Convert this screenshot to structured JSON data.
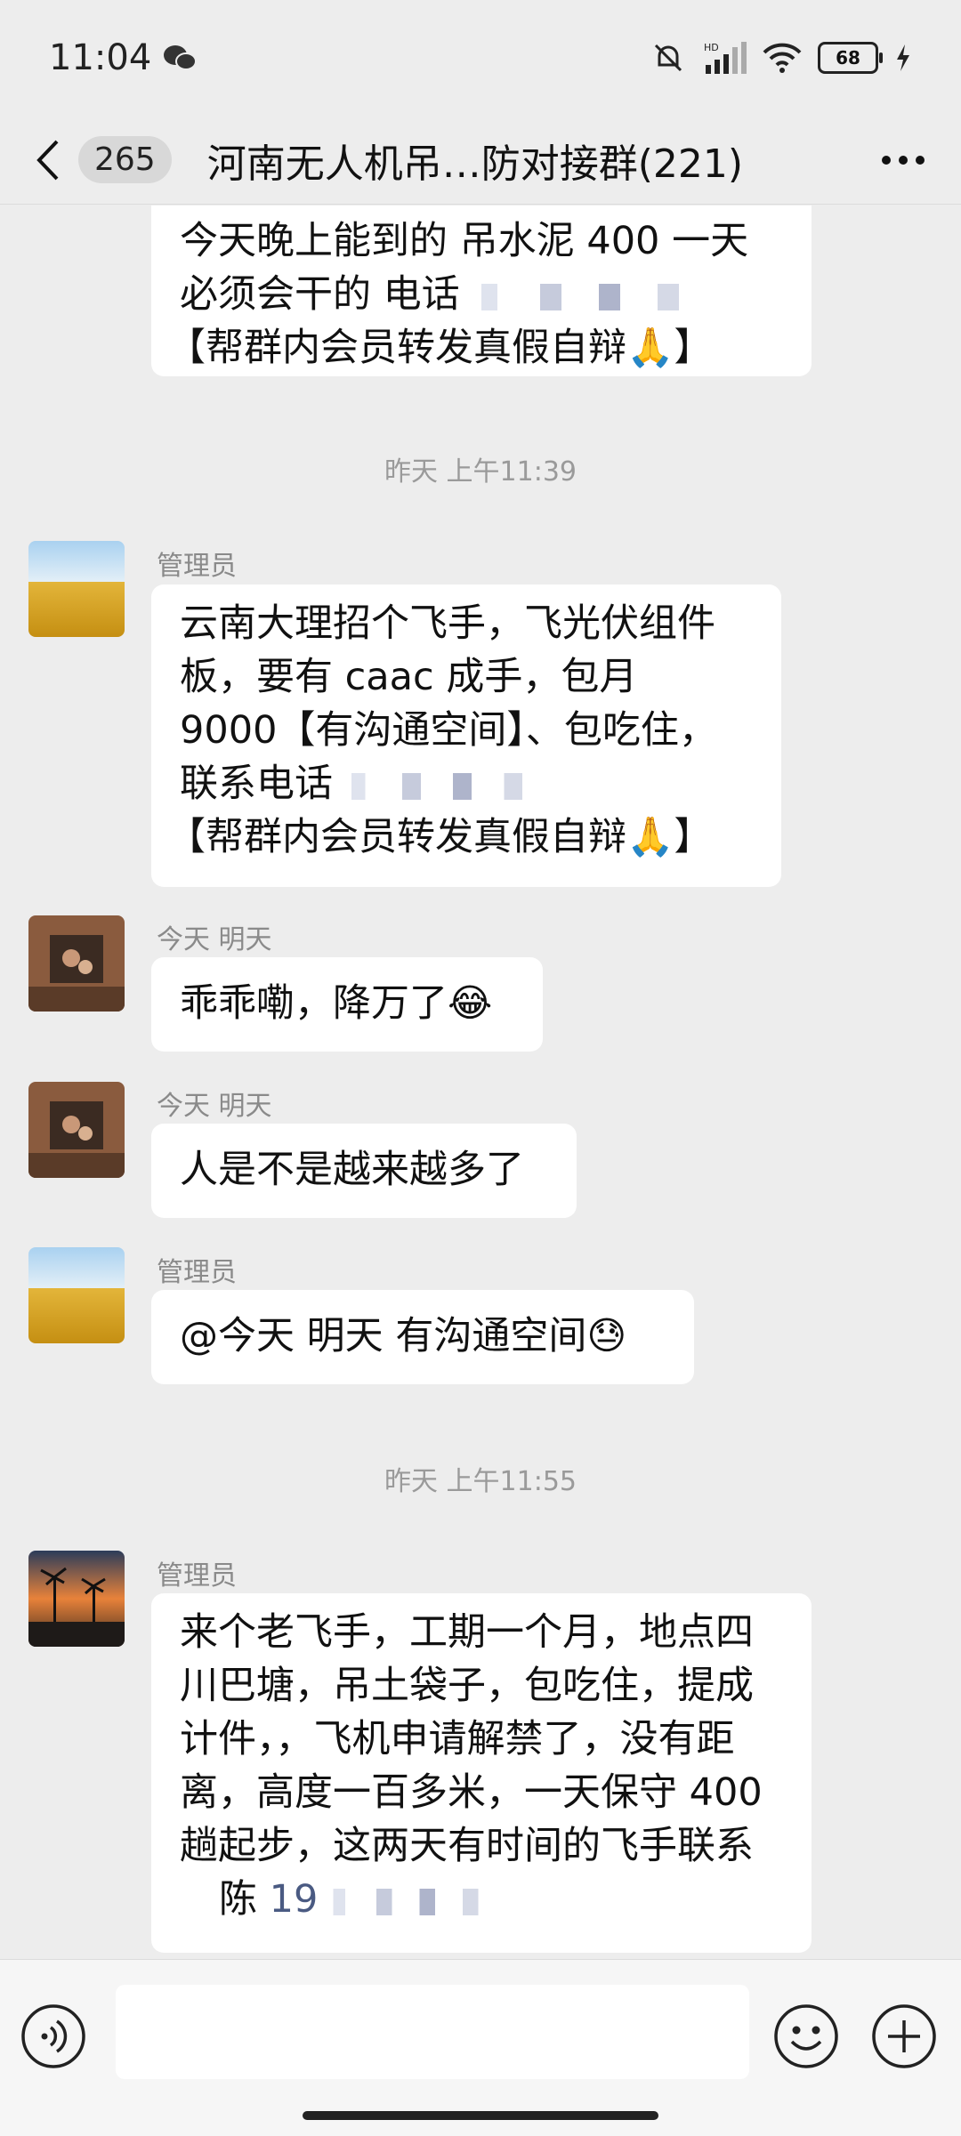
{
  "status_bar": {
    "time": "11:04",
    "battery": "68",
    "network_label": "HD"
  },
  "header": {
    "unread_count": "265",
    "title": "河南无人机吊…防对接群(221)"
  },
  "messages": [
    {
      "lines": [
        "今天晚上能到的 吊水泥 400 一天",
        "必须会干的  电话",
        "【帮群内会员转发真假自辩🙏】"
      ]
    },
    {
      "timestamp": "昨天 上午11:39"
    },
    {
      "sender": "管理员",
      "lines": [
        "云南大理招个飞手，飞光伏组件",
        "板，要有 caac 成手，包月",
        "9000【有沟通空间】、包吃住，",
        "联系电话",
        "【帮群内会员转发真假自辩🙏】"
      ]
    },
    {
      "sender": "今天 明天",
      "lines": [
        "乖乖嘞，降万了😂"
      ]
    },
    {
      "sender": "今天 明天",
      "lines": [
        "人是不是越来越多了"
      ]
    },
    {
      "sender": "管理员",
      "lines": [
        "@今天 明天  有沟通空间😓"
      ]
    },
    {
      "timestamp": "昨天 上午11:55"
    },
    {
      "sender": "管理员",
      "lines": [
        "来个老飞手，工期一个月，地点四",
        "川巴塘，吊土袋子，包吃住，提成",
        "计件，，飞机申请解禁了，没有距",
        "离，高度一百多米，一天保守 400",
        "趟起步，这两天有时间的飞手联系",
        "陈"
      ],
      "phone_prefix": "19"
    }
  ],
  "input": {
    "placeholder": ""
  },
  "colors": {
    "background": "#ededed",
    "bubble": "#ffffff",
    "timestamp": "#9a9a9a"
  }
}
